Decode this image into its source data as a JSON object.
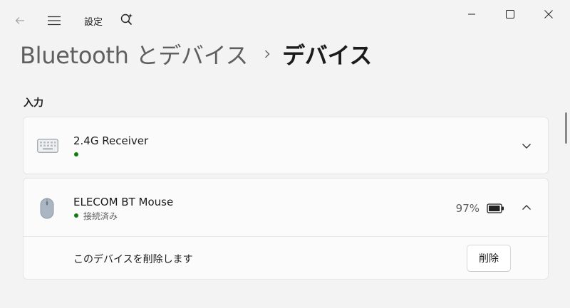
{
  "titlebar": {
    "app_title": "設定",
    "back_icon": "back-arrow-icon",
    "menu_icon": "hamburger-menu-icon",
    "app_icon": "search-sparkle-icon",
    "window_controls": [
      "minimize-icon",
      "maximize-icon",
      "close-icon"
    ]
  },
  "breadcrumb": {
    "parent": "Bluetooth とデバイス",
    "separator_icon": "chevron-right-icon",
    "current": "デバイス"
  },
  "section": {
    "label": "入力"
  },
  "devices": [
    {
      "name": "2.4G Receiver",
      "icon": "keyboard-icon",
      "status": "",
      "status_color": "#107c10",
      "expanded": false,
      "expand_icon": "chevron-down-icon"
    },
    {
      "name": "ELECOM BT Mouse",
      "icon": "mouse-icon",
      "status": "接続済み",
      "status_color": "#107c10",
      "battery": "97%",
      "battery_icon": "battery-icon",
      "battery_level": 0.97,
      "expanded": true,
      "expand_icon": "chevron-up-icon",
      "remove_text": "このデバイスを削除します",
      "remove_button": "削除"
    }
  ]
}
